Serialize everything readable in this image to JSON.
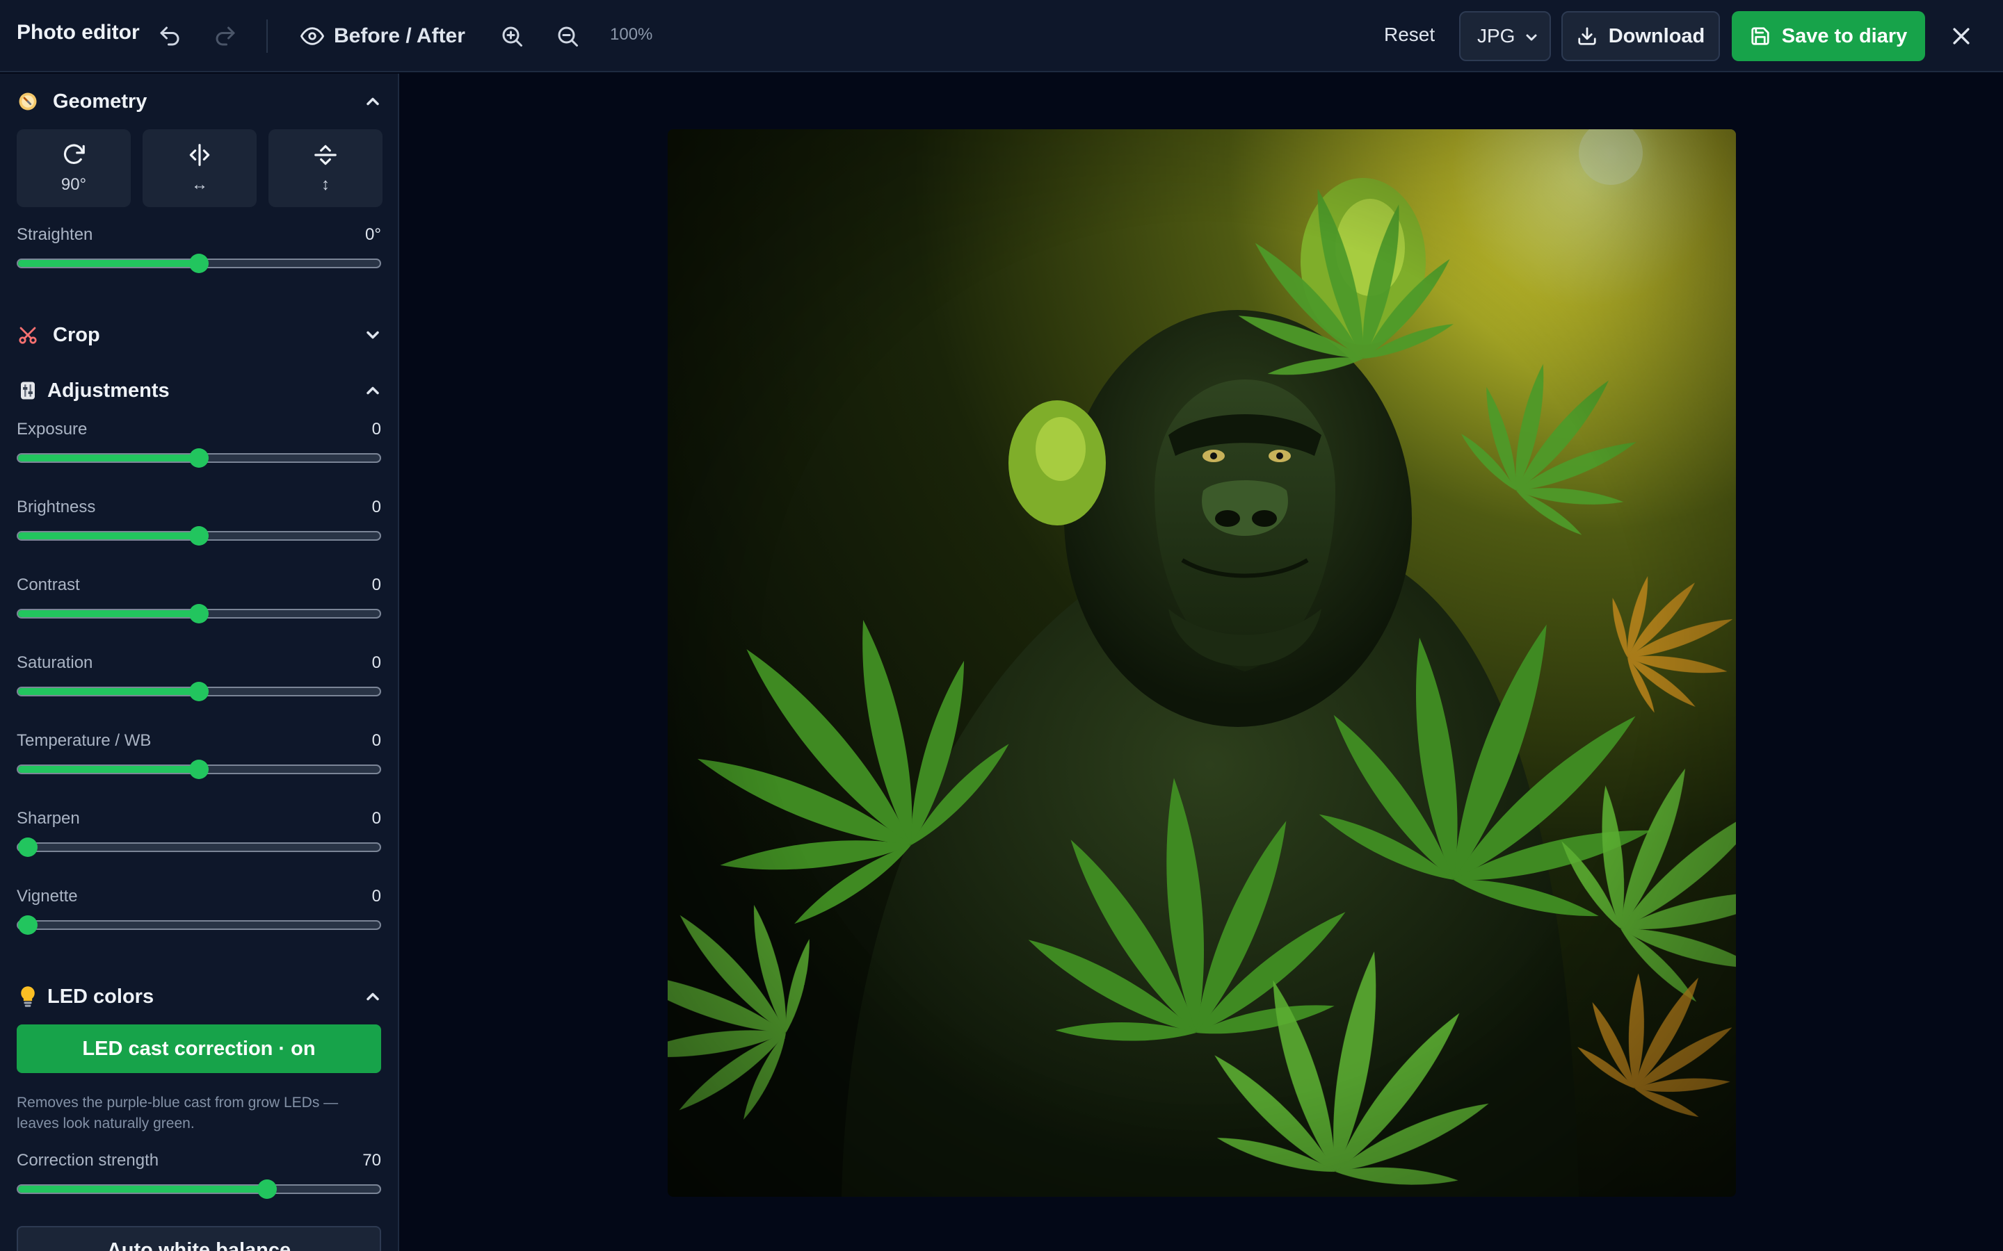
{
  "app": {
    "title": "Photo editor"
  },
  "toolbar": {
    "before_after": "Before / After",
    "zoom": "100%",
    "reset": "Reset",
    "format": "JPG",
    "download": "Download",
    "save": "Save to diary"
  },
  "geometry": {
    "title": "Geometry",
    "rotate_label": "90°",
    "flip_h_label": "↔",
    "flip_v_label": "↕",
    "straighten": {
      "label": "Straighten",
      "value": "0°",
      "level": 0.5
    }
  },
  "crop": {
    "title": "Crop"
  },
  "adjustments": {
    "title": "Adjustments",
    "sliders": [
      {
        "label": "Exposure",
        "value": "0",
        "level": 0.5
      },
      {
        "label": "Brightness",
        "value": "0",
        "level": 0.5
      },
      {
        "label": "Contrast",
        "value": "0",
        "level": 0.5
      },
      {
        "label": "Saturation",
        "value": "0",
        "level": 0.5
      },
      {
        "label": "Temperature / WB",
        "value": "0",
        "level": 0.5
      },
      {
        "label": "Sharpen",
        "value": "0",
        "level": 0.0
      },
      {
        "label": "Vignette",
        "value": "0",
        "level": 0.0
      }
    ]
  },
  "led": {
    "title": "LED colors",
    "toggle_label": "LED cast correction · on",
    "description": "Removes the purple-blue cast from grow LEDs — leaves look naturally green.",
    "strength": {
      "label": "Correction strength",
      "value": "70",
      "level": 0.7
    },
    "auto_wb_label": "Auto white balance"
  },
  "colors": {
    "accent": "#22c55e",
    "button_green": "#17a34a",
    "panel": "#0e172a",
    "canvas": "#030817"
  }
}
